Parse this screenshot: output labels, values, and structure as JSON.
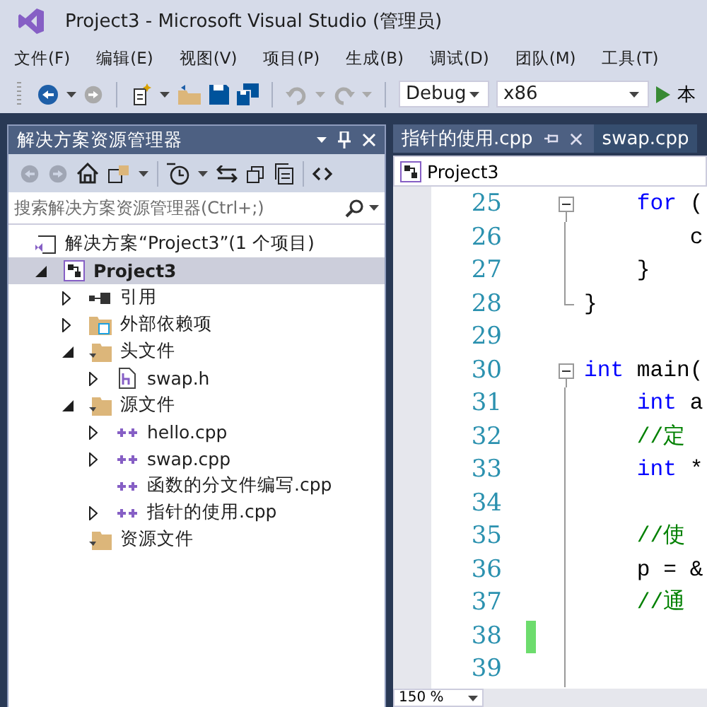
{
  "window": {
    "title": "Project3 - Microsoft Visual Studio (管理员)"
  },
  "menu": [
    "文件(F)",
    "编辑(E)",
    "视图(V)",
    "项目(P)",
    "生成(B)",
    "调试(D)",
    "团队(M)",
    "工具(T)"
  ],
  "toolbar": {
    "configuration": "Debug",
    "platform": "x86",
    "run_label": "本"
  },
  "solution_explorer": {
    "title": "解决方案资源管理器",
    "search": {
      "placeholder": "搜索解决方案资源管理器(Ctrl+;)"
    },
    "tree": {
      "label": "解决方案“Project3”(1 个项目)",
      "kind": "solution",
      "children": [
        {
          "label": "Project3",
          "kind": "project",
          "selected": true,
          "expandable": true,
          "expanded": true,
          "children": [
            {
              "label": "引用",
              "kind": "references",
              "selected": false,
              "expandable": true,
              "expanded": false
            },
            {
              "label": "外部依赖项",
              "kind": "external",
              "selected": false,
              "expandable": true,
              "expanded": false
            },
            {
              "label": "头文件",
              "kind": "filter",
              "selected": false,
              "expandable": true,
              "expanded": true,
              "children": [
                {
                  "label": "swap.h",
                  "kind": "header",
                  "selected": false,
                  "expandable": true,
                  "expanded": false
                }
              ]
            },
            {
              "label": "源文件",
              "kind": "filter",
              "selected": false,
              "expandable": true,
              "expanded": true,
              "children": [
                {
                  "label": "hello.cpp",
                  "kind": "source",
                  "selected": false,
                  "expandable": true,
                  "expanded": false
                },
                {
                  "label": "swap.cpp",
                  "kind": "source",
                  "selected": false,
                  "expandable": true,
                  "expanded": false
                },
                {
                  "label": "函数的分文件编写.cpp",
                  "kind": "source",
                  "selected": false,
                  "expandable": false
                },
                {
                  "label": "指针的使用.cpp",
                  "kind": "source",
                  "selected": false,
                  "expandable": true,
                  "expanded": false
                }
              ]
            },
            {
              "label": "资源文件",
              "kind": "filter",
              "selected": false,
              "expandable": false
            }
          ]
        }
      ]
    }
  },
  "editor": {
    "tabs": [
      {
        "label": "指针的使用.cpp",
        "selected": true
      },
      {
        "label": "swap.cpp",
        "selected": false
      }
    ],
    "navigation": "Project3",
    "zoom": "150 %",
    "lines": [
      {
        "number": "25",
        "collapsible": true,
        "block_end": false,
        "changed": false,
        "tokens": [
          {
            "kind": "keyword",
            "text": "    for"
          },
          {
            "kind": "plain",
            "text": " ("
          }
        ]
      },
      {
        "number": "26",
        "collapsible": false,
        "block_end": false,
        "changed": false,
        "tokens": [
          {
            "kind": "plain",
            "text": "        c"
          }
        ]
      },
      {
        "number": "27",
        "collapsible": false,
        "block_end": false,
        "changed": false,
        "tokens": [
          {
            "kind": "plain",
            "text": "    }"
          }
        ]
      },
      {
        "number": "28",
        "collapsible": false,
        "block_end": true,
        "changed": false,
        "tokens": [
          {
            "kind": "plain",
            "text": "}"
          }
        ]
      },
      {
        "number": "29",
        "collapsible": false,
        "block_end": false,
        "changed": false
      },
      {
        "number": "30",
        "collapsible": true,
        "block_end": false,
        "changed": false,
        "tokens": [
          {
            "kind": "keyword",
            "text": "int"
          },
          {
            "kind": "plain",
            "text": " main("
          }
        ]
      },
      {
        "number": "31",
        "collapsible": false,
        "block_end": false,
        "changed": false,
        "tokens": [
          {
            "kind": "keyword",
            "text": "    int"
          },
          {
            "kind": "plain",
            "text": " a"
          }
        ]
      },
      {
        "number": "32",
        "collapsible": false,
        "block_end": false,
        "changed": false,
        "tokens": [
          {
            "kind": "comment",
            "text": "    //定"
          }
        ]
      },
      {
        "number": "33",
        "collapsible": false,
        "block_end": false,
        "changed": false,
        "tokens": [
          {
            "kind": "keyword",
            "text": "    int"
          },
          {
            "kind": "plain",
            "text": " *"
          }
        ]
      },
      {
        "number": "34",
        "collapsible": false,
        "block_end": false,
        "changed": false
      },
      {
        "number": "35",
        "collapsible": false,
        "block_end": false,
        "changed": false,
        "tokens": [
          {
            "kind": "comment",
            "text": "    //使"
          }
        ]
      },
      {
        "number": "36",
        "collapsible": false,
        "block_end": false,
        "changed": false,
        "tokens": [
          {
            "kind": "plain",
            "text": "    p = &"
          }
        ]
      },
      {
        "number": "37",
        "collapsible": false,
        "block_end": false,
        "changed": false,
        "tokens": [
          {
            "kind": "comment",
            "text": "    //通"
          }
        ]
      },
      {
        "number": "38",
        "collapsible": false,
        "block_end": false,
        "changed": true
      },
      {
        "number": "39",
        "collapsible": false,
        "block_end": false,
        "changed": false
      }
    ]
  }
}
